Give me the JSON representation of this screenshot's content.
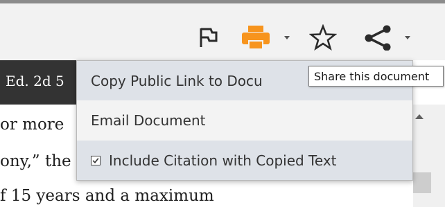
{
  "toolbar": {
    "icons": [
      "flag-icon",
      "print-icon",
      "star-icon",
      "share-icon"
    ],
    "print_color": "#f7941d"
  },
  "document": {
    "header_text": "Ed. 2d 5",
    "lines": [
      "or more",
      "ony,” the",
      "f 15 years and a maximum"
    ]
  },
  "share_menu": {
    "items": [
      {
        "label": "Copy Public Link to Docu"
      },
      {
        "label": "Email Document"
      },
      {
        "label": "Include Citation with Copied Text",
        "checked": true
      }
    ]
  },
  "tooltip": {
    "text": "Share this document"
  },
  "colors": {
    "toolbar_bg": "#f2f2f2",
    "doc_header_bg": "#333333",
    "menu_bg": "#f3f3f3",
    "menu_highlight": "#dee2e8"
  }
}
